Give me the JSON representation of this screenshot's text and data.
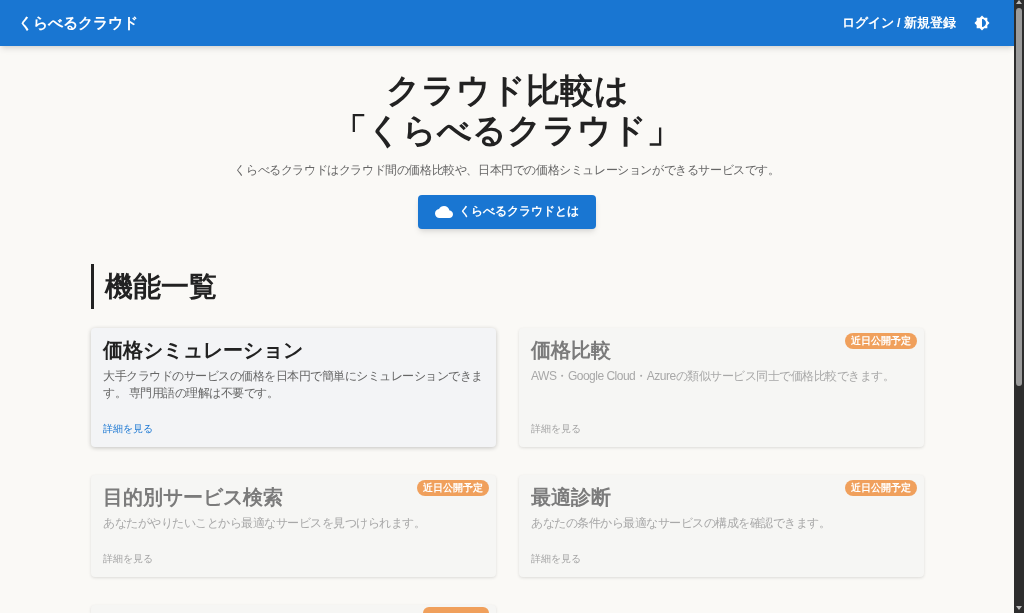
{
  "header": {
    "title": "くらべるクラウド",
    "login_link": "ログイン / 新規登録"
  },
  "hero": {
    "title_lines": [
      "クラウド比較は",
      "「くらべるクラウド」"
    ],
    "subtitle": "くらべるクラウドはクラウド間の価格比較や、日本円での価格シミュレーションができるサービスです。",
    "button": "くらべるクラウドとは"
  },
  "features": {
    "heading": "機能一覧",
    "cards": [
      {
        "title": "価格シミュレーション",
        "description": "大手クラウドのサービスの価格を日本円で簡単にシミュレーションできます。 専門用語の理解は不要です。",
        "link": "詳細を見る",
        "coming_soon": false
      },
      {
        "title": "価格比較",
        "description": "AWS・Google Cloud・Azureの類似サービス同士で価格比較できます。",
        "link": "詳細を見る",
        "coming_soon": true,
        "badge": "近日公開予定"
      },
      {
        "title": "目的別サービス検索",
        "description": "あなたがやりたいことから最適なサービスを見つけられます。",
        "link": "詳細を見る",
        "coming_soon": true,
        "badge": "近日公開予定"
      },
      {
        "title": "最適診断",
        "description": "あなたの条件から最適なサービスの構成を確認できます。",
        "link": "詳細を見る",
        "coming_soon": true,
        "badge": "近日公開予定"
      },
      {
        "coming_soon": true
      }
    ]
  }
}
